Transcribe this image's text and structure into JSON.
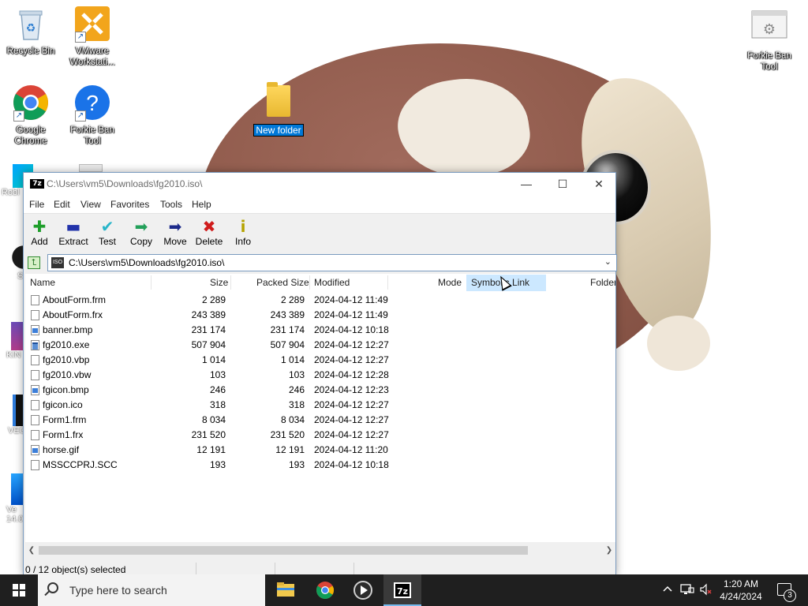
{
  "desktop": {
    "icons": [
      {
        "label": "Recycle Bin"
      },
      {
        "label": "VMware Workstati..."
      },
      {
        "label": "Google Chrome"
      },
      {
        "label": "Forkie Ban Tool"
      },
      {
        "label": "Forkie Ban Tool"
      }
    ],
    "partial_labels": [
      "Robl",
      "S",
      "KIN",
      "VEG",
      "Ve",
      "14.0"
    ],
    "new_folder_label": "New folder"
  },
  "window": {
    "title": "C:\\Users\\vm5\\Downloads\\fg2010.iso\\",
    "app_icon_text": "7z",
    "controls": {
      "minimize": "—",
      "maximize": "☐",
      "close": "✕"
    },
    "menu": [
      "File",
      "Edit",
      "View",
      "Favorites",
      "Tools",
      "Help"
    ],
    "toolbar": [
      {
        "label": "Add",
        "icon": "plus-icon",
        "glyph": "✚",
        "color": "#1e9e2a"
      },
      {
        "label": "Extract",
        "icon": "minus-icon",
        "glyph": "▬",
        "color": "#2233aa"
      },
      {
        "label": "Test",
        "icon": "check-icon",
        "glyph": "✔",
        "color": "#28b5c9"
      },
      {
        "label": "Copy",
        "icon": "copy-arrow-icon",
        "glyph": "➡",
        "color": "#23a05a"
      },
      {
        "label": "Move",
        "icon": "move-arrow-icon",
        "glyph": "➡",
        "color": "#1c2a8a"
      },
      {
        "label": "Delete",
        "icon": "delete-x-icon",
        "glyph": "✖",
        "color": "#d01c1c"
      },
      {
        "label": "Info",
        "icon": "info-icon",
        "glyph": "i",
        "color": "#b5a300"
      }
    ],
    "address": "C:\\Users\\vm5\\Downloads\\fg2010.iso\\",
    "address_icon_text": "ISO",
    "columns": {
      "name": "Name",
      "size": "Size",
      "packed": "Packed Size",
      "modified": "Modified",
      "mode": "Mode",
      "symlink": "Symbolic Link",
      "folder": "Folder"
    },
    "files": [
      {
        "name": "AboutForm.frm",
        "size": "2 289",
        "packed": "2 289",
        "modified": "2024-04-12 11:49",
        "icon": "file"
      },
      {
        "name": "AboutForm.frx",
        "size": "243 389",
        "packed": "243 389",
        "modified": "2024-04-12 11:49",
        "icon": "file"
      },
      {
        "name": "banner.bmp",
        "size": "231 174",
        "packed": "231 174",
        "modified": "2024-04-12 10:18",
        "icon": "img"
      },
      {
        "name": "fg2010.exe",
        "size": "507 904",
        "packed": "507 904",
        "modified": "2024-04-12 12:27",
        "icon": "exe"
      },
      {
        "name": "fg2010.vbp",
        "size": "1 014",
        "packed": "1 014",
        "modified": "2024-04-12 12:27",
        "icon": "file"
      },
      {
        "name": "fg2010.vbw",
        "size": "103",
        "packed": "103",
        "modified": "2024-04-12 12:28",
        "icon": "file"
      },
      {
        "name": "fgicon.bmp",
        "size": "246",
        "packed": "246",
        "modified": "2024-04-12 12:23",
        "icon": "img"
      },
      {
        "name": "fgicon.ico",
        "size": "318",
        "packed": "318",
        "modified": "2024-04-12 12:27",
        "icon": "file"
      },
      {
        "name": "Form1.frm",
        "size": "8 034",
        "packed": "8 034",
        "modified": "2024-04-12 12:27",
        "icon": "file"
      },
      {
        "name": "Form1.frx",
        "size": "231 520",
        "packed": "231 520",
        "modified": "2024-04-12 12:27",
        "icon": "file"
      },
      {
        "name": "horse.gif",
        "size": "12 191",
        "packed": "12 191",
        "modified": "2024-04-12 11:20",
        "icon": "img"
      },
      {
        "name": "MSSCCPRJ.SCC",
        "size": "193",
        "packed": "193",
        "modified": "2024-04-12 10:18",
        "icon": "file"
      }
    ],
    "status": "0 / 12 object(s) selected"
  },
  "taskbar": {
    "search_placeholder": "Type here to search",
    "time": "1:20 AM",
    "date": "4/24/2024",
    "notification_count": "3",
    "apps": [
      "file-explorer",
      "google-chrome",
      "media-player",
      "7-zip"
    ]
  },
  "colors": {
    "accent": "#0078d7",
    "header_highlight": "#cce8ff",
    "taskbar": "#1f1f1f"
  }
}
